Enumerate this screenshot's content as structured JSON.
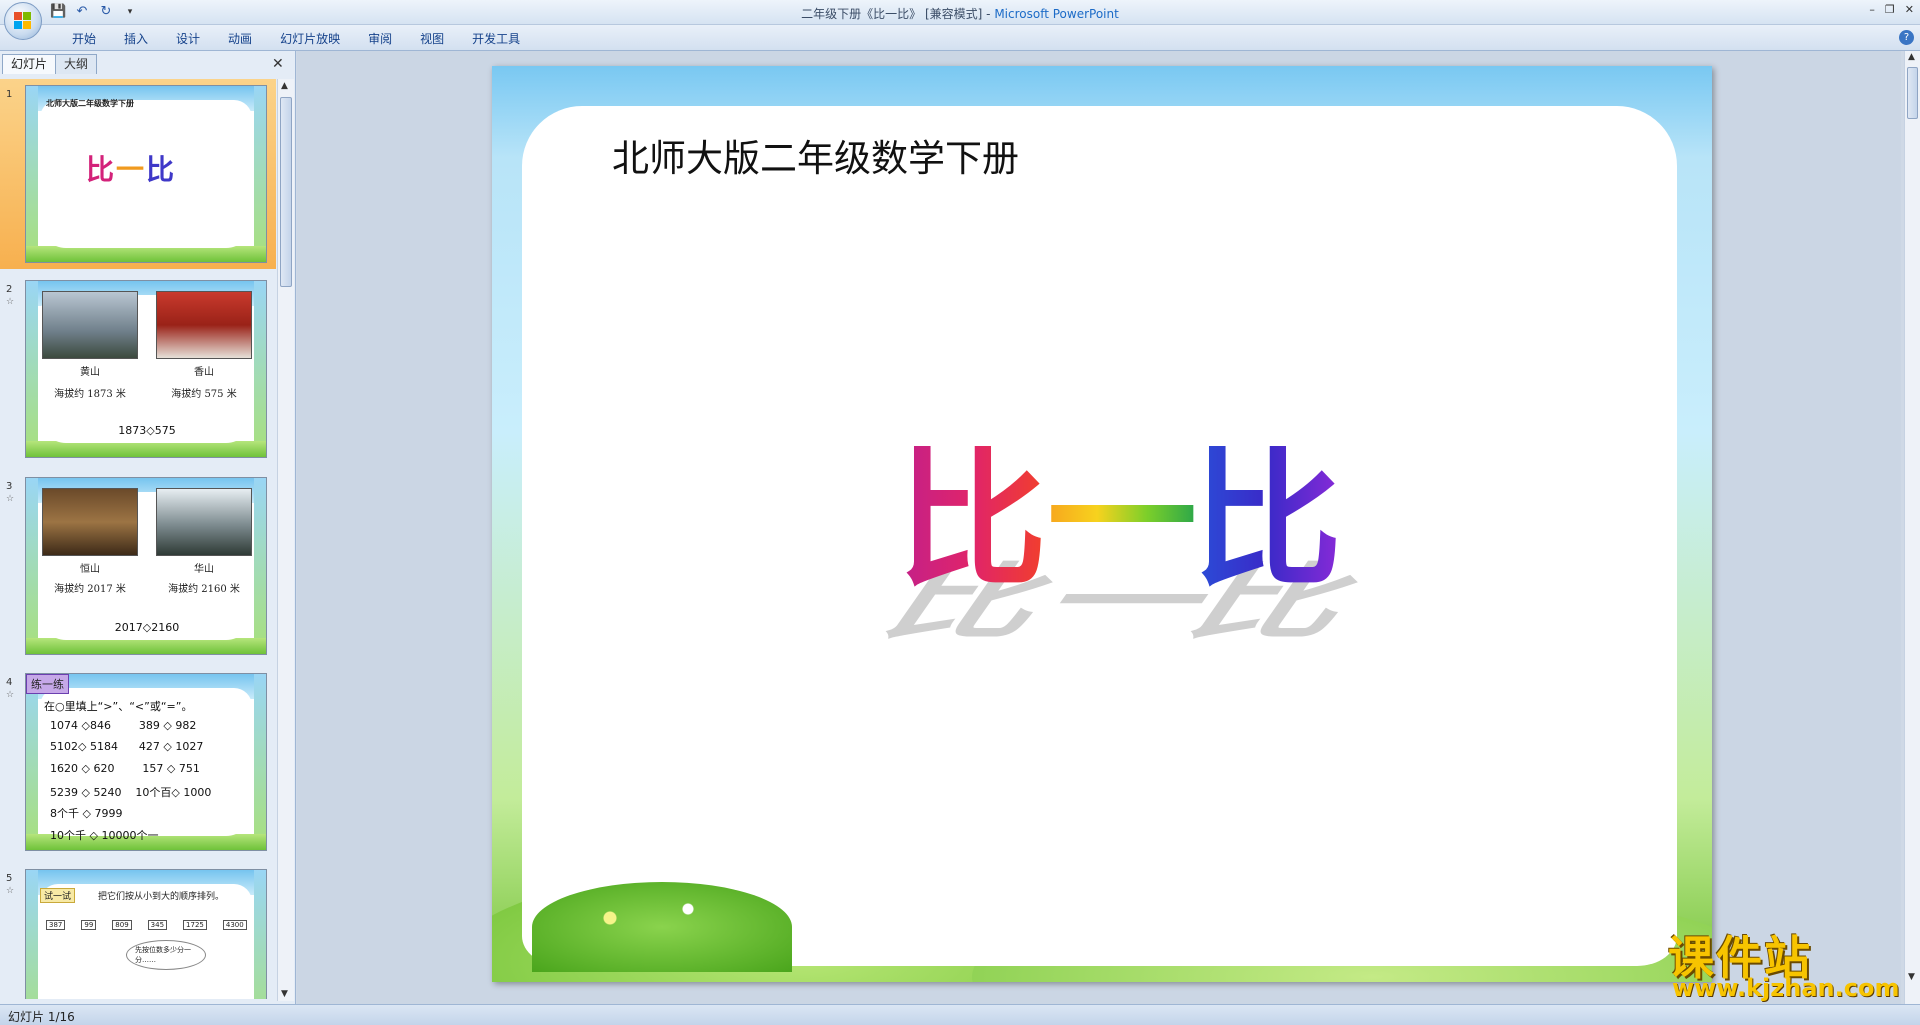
{
  "window": {
    "title_doc": "二年级下册《比一比》 [兼容模式] - ",
    "title_app": "Microsoft PowerPoint",
    "controls": [
      "–",
      "❐",
      "✕"
    ]
  },
  "qat": {
    "save": "💾",
    "undo": "↶",
    "redo": "↻",
    "more": "▾"
  },
  "menu": [
    "开始",
    "插入",
    "设计",
    "动画",
    "幻灯片放映",
    "审阅",
    "视图",
    "开发工具"
  ],
  "help": "?",
  "pane": {
    "tabs": [
      "幻灯片",
      "大纲"
    ],
    "close": "✕",
    "scroll_up": "▲",
    "scroll_down": "▼"
  },
  "slides": [
    {
      "num": "1",
      "title": "北师大版二年级数学下册",
      "big": "比一比"
    },
    {
      "num": "2",
      "captions": [
        [
          "黄山",
          "海拔约 1873 米"
        ],
        [
          "香山",
          "海拔约 575 米"
        ]
      ],
      "compare": "1873◇575"
    },
    {
      "num": "3",
      "captions": [
        [
          "恒山",
          "海拔约 2017 米"
        ],
        [
          "华山",
          "海拔约 2160 米"
        ]
      ],
      "compare": "2017◇2160"
    },
    {
      "num": "4",
      "header": "练一练",
      "instruction": "在○里填上“>”、“<”或“=”。",
      "lines": [
        "1074 ◇846        389 ◇ 982",
        "5102◇ 5184      427 ◇ 1027",
        "1620 ◇ 620        157 ◇ 751",
        "5239 ◇ 5240    10个百◇ 1000",
        "8个千 ◇ 7999",
        "10个千 ◇ 10000个一"
      ]
    },
    {
      "num": "5",
      "header": "试一试",
      "instruction": "把它们按从小到大的顺序排列。",
      "numbers": [
        "387",
        "99",
        "809",
        "345",
        "1725",
        "4300"
      ],
      "bubble": "先按位数多少分一分……"
    }
  ],
  "main_slide": {
    "title": "北师大版二年级数学下册",
    "big_chars": [
      "比",
      "一",
      "比"
    ]
  },
  "status": {
    "slide_counter": "幻灯片 1/16"
  },
  "watermark": {
    "line1": "课件站",
    "line2": "www.kjzhan.com"
  }
}
